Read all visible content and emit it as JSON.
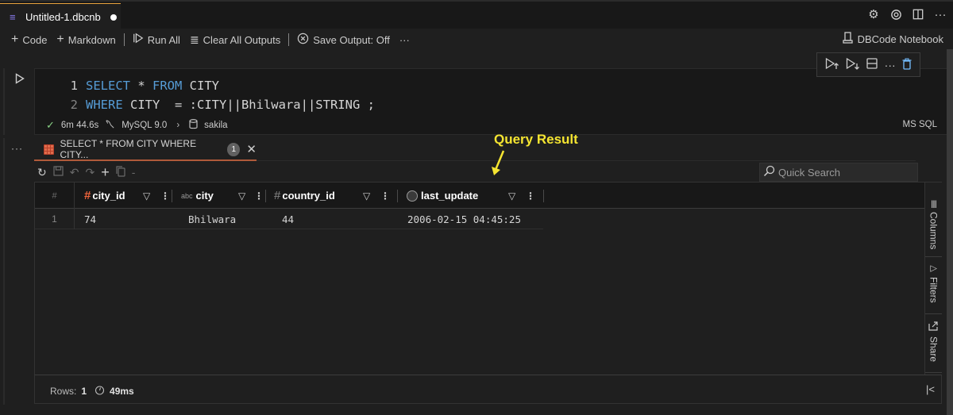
{
  "tab": {
    "title": "Untitled-1.dbcnb",
    "dirty": true,
    "icon": "database-icon"
  },
  "title_actions": [
    "settings-gear-icon",
    "settings-outline-icon",
    "split-editor-icon",
    "more-icon"
  ],
  "toolbar": {
    "add_code": "Code",
    "add_markdown": "Markdown",
    "run_all": "Run All",
    "clear_outputs": "Clear All Outputs",
    "save_output": "Save Output: Off",
    "kernel": "DBCode Notebook"
  },
  "cell": {
    "code": [
      {
        "line": "1",
        "tokens": [
          {
            "t": "SELECT",
            "kw": true
          },
          {
            "t": " * ",
            "kw": false
          },
          {
            "t": "FROM",
            "kw": true
          },
          {
            "t": " CITY",
            "kw": false
          }
        ]
      },
      {
        "line": "2",
        "tokens": [
          {
            "t": "WHERE",
            "kw": true
          },
          {
            "t": " CITY  = :CITY||Bhilwara||STRING ;",
            "kw": false
          }
        ]
      }
    ],
    "status": {
      "duration": "6m 44.6s",
      "engine": "MySQL 9.0",
      "database": "sakila"
    },
    "language": "MS SQL",
    "cell_actions": [
      "execute-above-icon",
      "execute-below-icon",
      "split-cell-icon",
      "more-icon",
      "delete-icon"
    ]
  },
  "output": {
    "tab_label": "SELECT * FROM CITY WHERE CITY...",
    "tab_badge": "1",
    "quick_search_placeholder": "Quick Search",
    "columns": [
      {
        "name": "city_id",
        "type": "number"
      },
      {
        "name": "city",
        "type": "text"
      },
      {
        "name": "country_id",
        "type": "number"
      },
      {
        "name": "last_update",
        "type": "timestamp"
      }
    ],
    "row_header": "#",
    "rows": [
      {
        "index": "1",
        "values": [
          "74",
          "Bhilwara",
          "44",
          "2006-02-15 04:45:25"
        ]
      }
    ],
    "side_tabs": [
      "Columns",
      "Filters",
      "Share"
    ],
    "footer": {
      "rows_label": "Rows:",
      "rows_count": "1",
      "time": "49ms"
    }
  },
  "annotation": {
    "text": "Query Result",
    "color": "#f5e531"
  },
  "colors": {
    "accent_tab": "#e8a33d",
    "keyword": "#569cd6",
    "number_icon": "#f0643c",
    "success": "#89d185"
  }
}
